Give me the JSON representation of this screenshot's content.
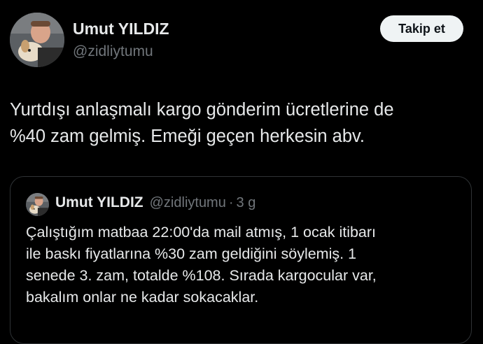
{
  "author": {
    "name": "Umut YILDIZ",
    "handle": "@zidliytumu",
    "avatar_icon": "profile-photo-with-dog"
  },
  "follow_button": {
    "label": "Takip et"
  },
  "tweet": {
    "lines": [
      "Yurtdışı anlaşmalı kargo gönderim ücretlerine de",
      "%40 zam gelmiş. Emeği geçen herkesin abv."
    ]
  },
  "quoted_tweet": {
    "name": "Umut YILDIZ",
    "handle": "@zidliytumu",
    "separator": "·",
    "time": "3 g",
    "lines": [
      "Çalıştığım matbaa 22:00'da mail atmış, 1 ocak itibarı",
      "ile baskı fiyatlarına %30 zam geldiğini söylemiş. 1",
      "senede 3. zam, totalde %108. Sırada kargocular var,",
      "bakalım onlar ne kadar sokacaklar."
    ]
  },
  "colors": {
    "background": "#000000",
    "text_primary": "#e7e9ea",
    "text_secondary": "#71767b",
    "border": "#2f3336",
    "button_bg": "#eff3f4",
    "button_text": "#0f1419"
  }
}
